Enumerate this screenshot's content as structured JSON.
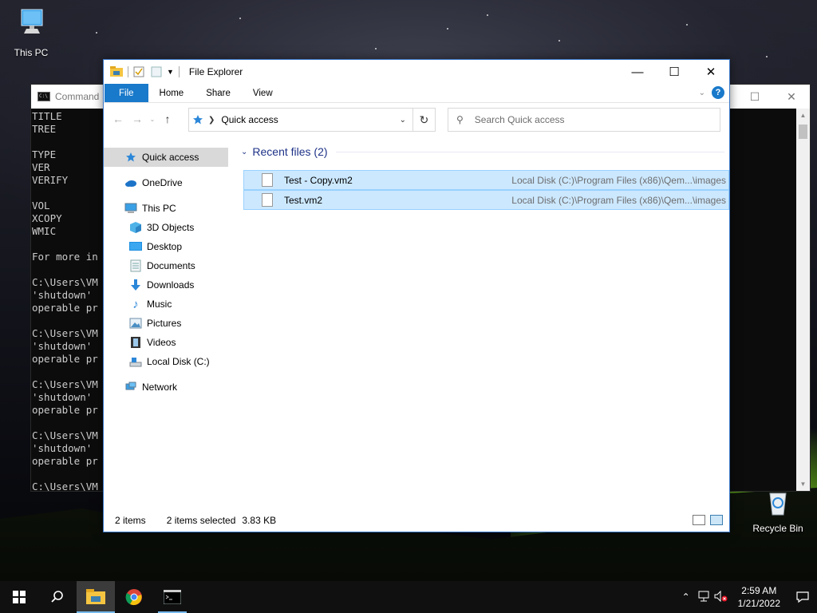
{
  "desktop": {
    "icons": [
      {
        "label": "This PC"
      },
      {
        "label": "Recycle Bin"
      }
    ]
  },
  "cmd": {
    "title": "Command",
    "lines": [
      "TITLE",
      "TREE",
      "",
      "TYPE",
      "VER",
      "VERIFY",
      "",
      "VOL",
      "XCOPY",
      "WMIC",
      "",
      "For more in",
      "",
      "C:\\Users\\VM",
      "'shutdown' ",
      "operable pr",
      "",
      "C:\\Users\\VM",
      "'shutdown' ",
      "operable pr",
      "",
      "C:\\Users\\VM",
      "'shutdown' ",
      "operable pr",
      "",
      "C:\\Users\\VM",
      "'shutdown' ",
      "operable pr",
      "",
      "C:\\Users\\VM"
    ]
  },
  "explorer": {
    "title": "File Explorer",
    "ribbon": {
      "tabs": [
        "File",
        "Home",
        "Share",
        "View"
      ]
    },
    "address": {
      "location": "Quick access"
    },
    "search": {
      "placeholder": "Search Quick access"
    },
    "nav": {
      "quick_access": "Quick access",
      "onedrive": "OneDrive",
      "this_pc": "This PC",
      "objects3d": "3D Objects",
      "desktop": "Desktop",
      "documents": "Documents",
      "downloads": "Downloads",
      "music": "Music",
      "pictures": "Pictures",
      "videos": "Videos",
      "local_disk": "Local Disk (C:)",
      "network": "Network"
    },
    "group": {
      "header": "Recent files (2)"
    },
    "files": [
      {
        "name": "Test - Copy.vm2",
        "location": "Local Disk (C:)\\Program Files (x86)\\Qem...\\images"
      },
      {
        "name": "Test.vm2",
        "location": "Local Disk (C:)\\Program Files (x86)\\Qem...\\images"
      }
    ],
    "status": {
      "items": "2 items",
      "selected": "2 items selected",
      "size": "3.83 KB"
    }
  },
  "taskbar": {
    "time": "2:59 AM",
    "date": "1/21/2022"
  },
  "colors": {
    "accent": "#1979ca",
    "selection": "#cce8ff",
    "group_header": "#1e3287"
  }
}
